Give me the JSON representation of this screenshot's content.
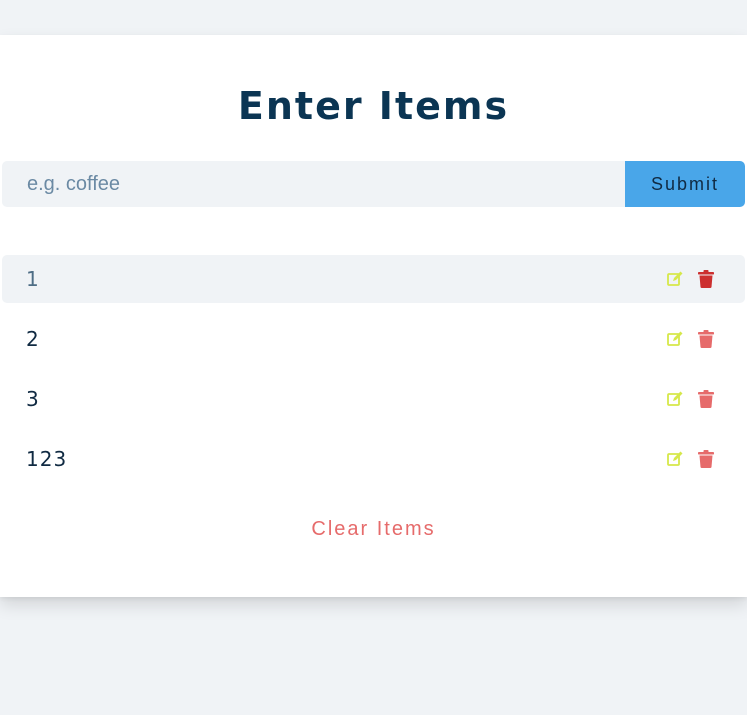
{
  "header": {
    "title": "Enter Items"
  },
  "form": {
    "placeholder": "e.g. coffee",
    "value": "",
    "submit_label": "Submit"
  },
  "items": [
    {
      "title": "1"
    },
    {
      "title": "2"
    },
    {
      "title": "3"
    },
    {
      "title": "123"
    }
  ],
  "icons": {
    "edit": "edit-icon",
    "delete": "trash-icon"
  },
  "colors": {
    "accent": "#49a6e9",
    "edit": "#d6e84a",
    "delete": "#e66b6b",
    "delete_active": "#cc2f2f",
    "title": "#0b3553"
  },
  "footer": {
    "clear_label": "Clear Items"
  }
}
